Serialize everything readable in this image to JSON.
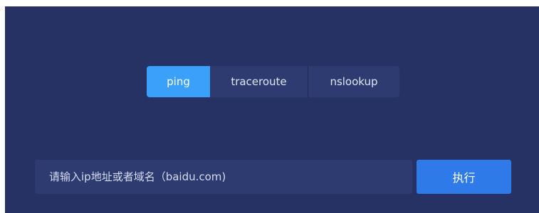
{
  "tabs": [
    {
      "label": "ping",
      "active": true
    },
    {
      "label": "traceroute",
      "active": false
    },
    {
      "label": "nslookup",
      "active": false
    }
  ],
  "input": {
    "value": "",
    "placeholder": "请输入ip地址或者域名（baidu.com)"
  },
  "execute_button": {
    "label": "执行"
  },
  "colors": {
    "panel_background": "#253263",
    "tab_background": "#2d3b70",
    "active_tab": "#3aa0fa",
    "button": "#2e7ae8"
  }
}
